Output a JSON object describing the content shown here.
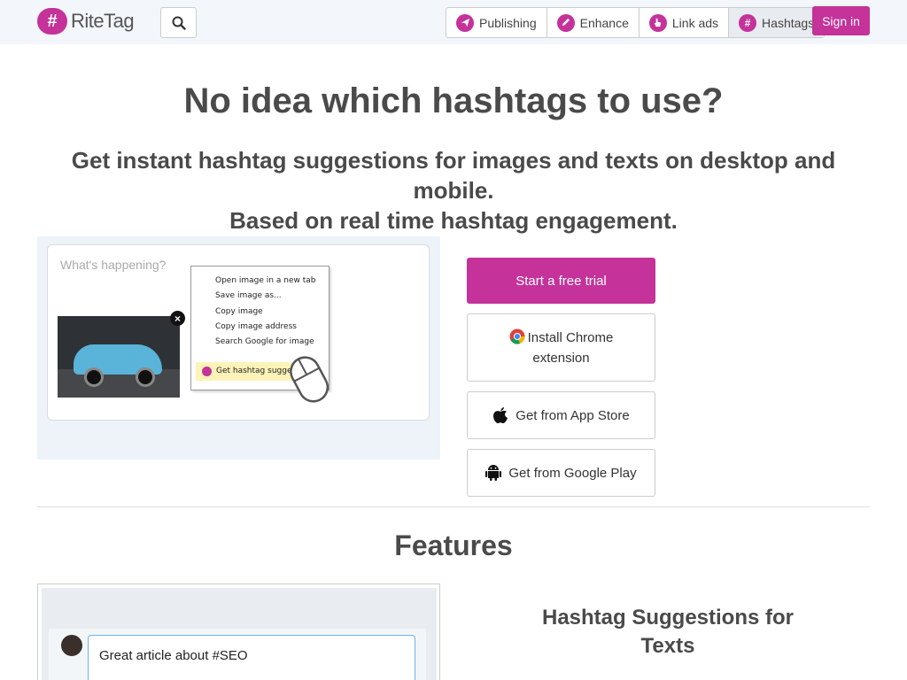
{
  "header": {
    "logo_text": "RiteTag",
    "logo_mark": "#",
    "search_icon": "search-icon",
    "nav": [
      {
        "label": "Publishing",
        "icon": "paper-plane-icon"
      },
      {
        "label": "Enhance",
        "icon": "pencil-icon"
      },
      {
        "label": "Link ads",
        "icon": "pointer-hand-icon"
      },
      {
        "label": "Hashtags",
        "icon": "hashtag-icon"
      }
    ],
    "signin_label": "Sign in"
  },
  "hero": {
    "title": "No idea which hashtags to use?",
    "subtitle_line1": "Get instant hashtag suggestions for images and texts on desktop and mobile.",
    "subtitle_line2": "Based on real time hashtag engagement."
  },
  "demo": {
    "placeholder": "What's happening?",
    "context_menu": [
      "Open image in a new tab",
      "Save image as...",
      "Copy image",
      "Copy image address",
      "Search Google for image"
    ],
    "highlighted_item": "Get hashtag suggestions"
  },
  "cta": {
    "trial_label": "Start a free trial",
    "chrome_label": "Install Chrome extension",
    "appstore_label": "Get from App Store",
    "googleplay_label": "Get from Google Play"
  },
  "features": {
    "title": "Features",
    "preview_text": "Great article about #SEO",
    "heading": "Hashtag Suggestions for Texts"
  },
  "colors": {
    "brand": "#c4329a",
    "header_bg": "#f3f6fa",
    "demo_bg": "#edf3f9"
  }
}
